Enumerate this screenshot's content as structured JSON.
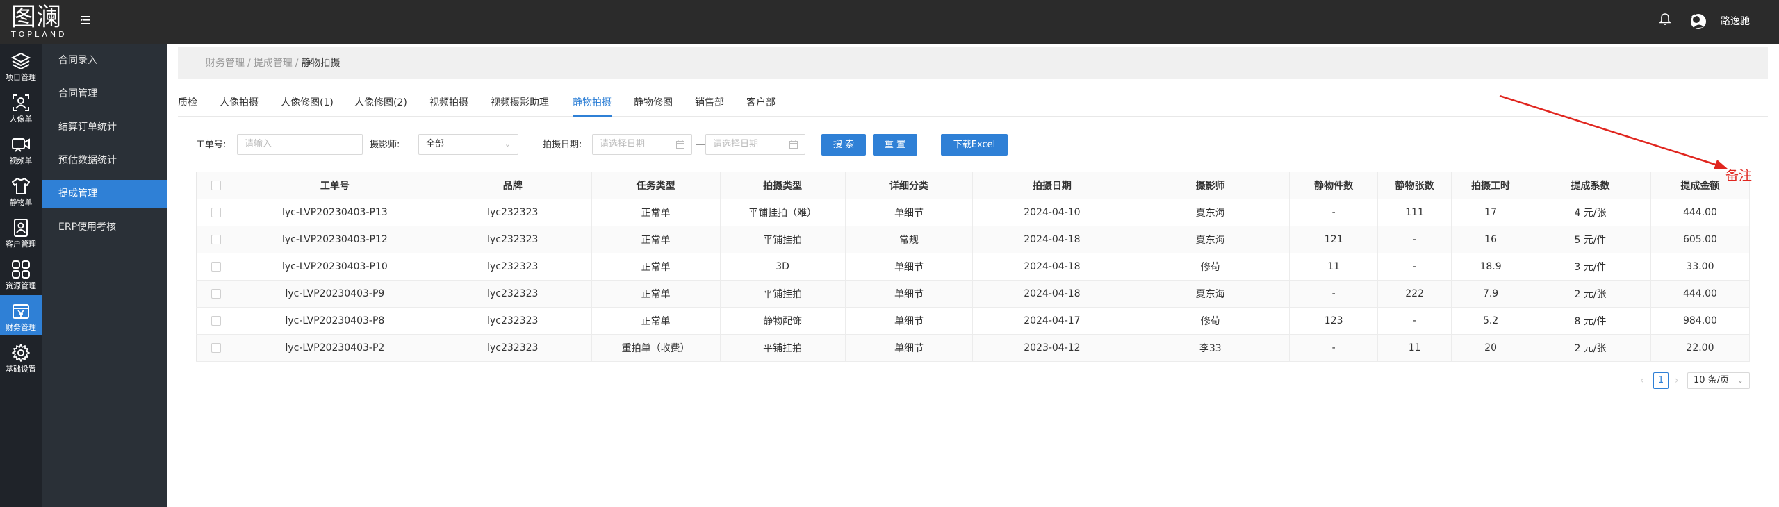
{
  "header": {
    "logo_text": "图澜",
    "logo_sub": "TOPLAND",
    "user_name": "路逸驰"
  },
  "rail": {
    "items": [
      {
        "label": "项目管理",
        "icon": "layers-icon"
      },
      {
        "label": "人像单",
        "icon": "portrait-icon"
      },
      {
        "label": "视频单",
        "icon": "video-icon"
      },
      {
        "label": "静物单",
        "icon": "shirt-icon"
      },
      {
        "label": "客户管理",
        "icon": "contact-card-icon"
      },
      {
        "label": "资源管理",
        "icon": "grid-icon"
      },
      {
        "label": "财务管理",
        "icon": "finance-icon"
      },
      {
        "label": "基础设置",
        "icon": "gear-icon"
      }
    ]
  },
  "submenu": {
    "items": [
      {
        "label": "合同录入"
      },
      {
        "label": "合同管理"
      },
      {
        "label": "结算订单统计"
      },
      {
        "label": "预估数据统计"
      },
      {
        "label": "提成管理"
      },
      {
        "label": "ERP使用考核"
      }
    ]
  },
  "breadcrumb": {
    "items": [
      "财务管理",
      "提成管理"
    ],
    "current": "静物拍摄"
  },
  "tabs": [
    {
      "label": "质检"
    },
    {
      "label": "人像拍摄"
    },
    {
      "label": "人像修图(1)"
    },
    {
      "label": "人像修图(2)"
    },
    {
      "label": "视频拍摄"
    },
    {
      "label": "视频摄影助理"
    },
    {
      "label": "静物拍摄"
    },
    {
      "label": "静物修图"
    },
    {
      "label": "销售部"
    },
    {
      "label": "客户部"
    }
  ],
  "filters": {
    "order_no_label": "工单号:",
    "order_no_placeholder": "请输入",
    "photographer_label": "摄影师:",
    "photographer_value": "全部",
    "date_label": "拍摄日期:",
    "date_start_placeholder": "请选择日期",
    "date_sep": "—",
    "date_end_placeholder": "请选择日期",
    "search_label": "搜 索",
    "reset_label": "重 置",
    "export_label": "下载Excel"
  },
  "table": {
    "columns": [
      "工单号",
      "品牌",
      "任务类型",
      "拍摄类型",
      "详细分类",
      "拍摄日期",
      "摄影师",
      "静物件数",
      "静物张数",
      "拍摄工时",
      "提成系数",
      "提成金额"
    ],
    "rows": [
      [
        "lyc-LVP20230403-P13",
        "lyc232323",
        "正常单",
        "平铺挂拍（难）",
        "单细节",
        "2024-04-10",
        "夏东海",
        "-",
        "111",
        "17",
        "4 元/张",
        "444.00"
      ],
      [
        "lyc-LVP20230403-P12",
        "lyc232323",
        "正常单",
        "平铺挂拍",
        "常规",
        "2024-04-18",
        "夏东海",
        "121",
        "-",
        "16",
        "5 元/件",
        "605.00"
      ],
      [
        "lyc-LVP20230403-P10",
        "lyc232323",
        "正常单",
        "3D",
        "单细节",
        "2024-04-18",
        "修苟",
        "11",
        "-",
        "18.9",
        "3 元/件",
        "33.00"
      ],
      [
        "lyc-LVP20230403-P9",
        "lyc232323",
        "正常单",
        "平铺挂拍",
        "单细节",
        "2024-04-18",
        "夏东海",
        "-",
        "222",
        "7.9",
        "2 元/张",
        "444.00"
      ],
      [
        "lyc-LVP20230403-P8",
        "lyc232323",
        "正常单",
        "静物配饰",
        "单细节",
        "2024-04-17",
        "修苟",
        "123",
        "-",
        "5.2",
        "8 元/件",
        "984.00"
      ],
      [
        "lyc-LVP20230403-P2",
        "lyc232323",
        "重拍单（收费）",
        "平铺挂拍",
        "单细节",
        "2023-04-12",
        "李33",
        "-",
        "11",
        "20",
        "2 元/张",
        "22.00"
      ]
    ]
  },
  "pagination": {
    "current_page": "1",
    "page_size": "10 条/页"
  },
  "annotation": {
    "text": "备注",
    "color": "#e0261f"
  },
  "colors": {
    "accent": "#2f80d6",
    "topbar": "#2b2b2b",
    "rail": "#1f2329",
    "submenu": "#2a3037"
  }
}
